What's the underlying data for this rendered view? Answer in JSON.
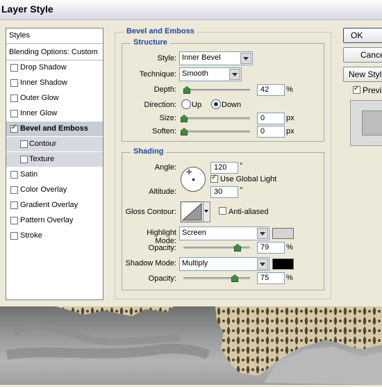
{
  "window": {
    "title": "Layer Style"
  },
  "sidebar": {
    "header": "Styles",
    "blending": "Blending Options: Custom",
    "items": [
      {
        "label": "Drop Shadow",
        "checked": false
      },
      {
        "label": "Inner Shadow",
        "checked": false
      },
      {
        "label": "Outer Glow",
        "checked": false
      },
      {
        "label": "Inner Glow",
        "checked": false
      },
      {
        "label": "Bevel and Emboss",
        "checked": true
      },
      {
        "label": "Contour",
        "checked": false
      },
      {
        "label": "Texture",
        "checked": false
      },
      {
        "label": "Satin",
        "checked": false
      },
      {
        "label": "Color Overlay",
        "checked": false
      },
      {
        "label": "Gradient Overlay",
        "checked": false
      },
      {
        "label": "Pattern Overlay",
        "checked": false
      },
      {
        "label": "Stroke",
        "checked": false
      }
    ]
  },
  "bevel": {
    "title": "Bevel and Emboss",
    "structure": {
      "title": "Structure",
      "style_label": "Style:",
      "style_value": "Inner Bevel",
      "technique_label": "Technique:",
      "technique_value": "Smooth",
      "depth_label": "Depth:",
      "depth_value": "42",
      "depth_unit": "%",
      "depth_fraction": 0.04,
      "direction_label": "Direction:",
      "up_label": "Up",
      "down_label": "Down",
      "direction": "Down",
      "size_label": "Size:",
      "size_value": "0",
      "size_unit": "px",
      "soften_label": "Soften:",
      "soften_value": "0",
      "soften_unit": "px"
    },
    "shading": {
      "title": "Shading",
      "angle_label": "Angle:",
      "angle_value": "120",
      "angle_unit": "°",
      "global_light_label": "Use Global Light",
      "global_light": true,
      "altitude_label": "Altitude:",
      "altitude_value": "30",
      "altitude_unit": "°",
      "gloss_label": "Gloss Contour:",
      "antialias_label": "Anti-aliased",
      "antialias": false,
      "highlight_label": "Highlight Mode:",
      "highlight_value": "Screen",
      "highlight_color": "#d4d4d4",
      "h_opacity_label": "Opacity:",
      "h_opacity_value": "79",
      "h_opacity_unit": "%",
      "shadow_label": "Shadow Mode:",
      "shadow_value": "Multiply",
      "shadow_color": "#000000",
      "s_opacity_label": "Opacity:",
      "s_opacity_value": "75",
      "s_opacity_unit": "%"
    }
  },
  "buttons": {
    "ok": "OK",
    "cancel": "Cancel",
    "new_style": "New Style...",
    "preview": "Preview"
  }
}
